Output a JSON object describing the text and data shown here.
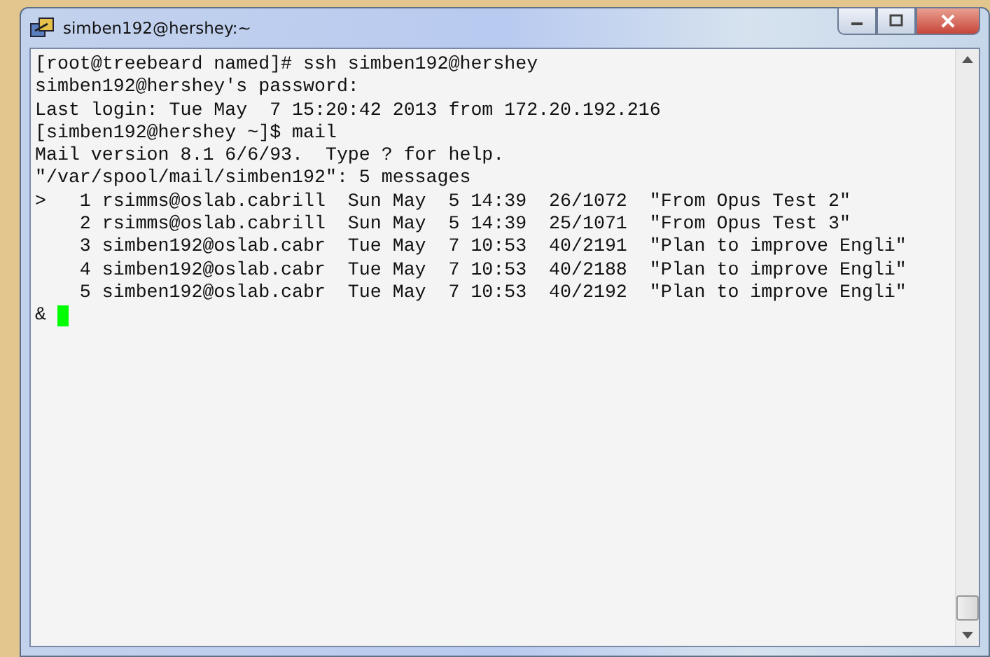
{
  "window": {
    "title": "simben192@hershey:~"
  },
  "terminal": {
    "lines": [
      "[root@treebeard named]# ssh simben192@hershey",
      "simben192@hershey's password:",
      "Last login: Tue May  7 15:20:42 2013 from 172.20.192.216",
      "[simben192@hershey ~]$ mail",
      "Mail version 8.1 6/6/93.  Type ? for help.",
      "\"/var/spool/mail/simben192\": 5 messages",
      ">   1 rsimms@oslab.cabrill  Sun May  5 14:39  26/1072  \"From Opus Test 2\"",
      "    2 rsimms@oslab.cabrill  Sun May  5 14:39  25/1071  \"From Opus Test 3\"",
      "    3 simben192@oslab.cabr  Tue May  7 10:53  40/2191  \"Plan to improve Engli\"",
      "    4 simben192@oslab.cabr  Tue May  7 10:53  40/2188  \"Plan to improve Engli\"",
      "    5 simben192@oslab.cabr  Tue May  7 10:53  40/2192  \"Plan to improve Engli\""
    ],
    "prompt": "&"
  }
}
